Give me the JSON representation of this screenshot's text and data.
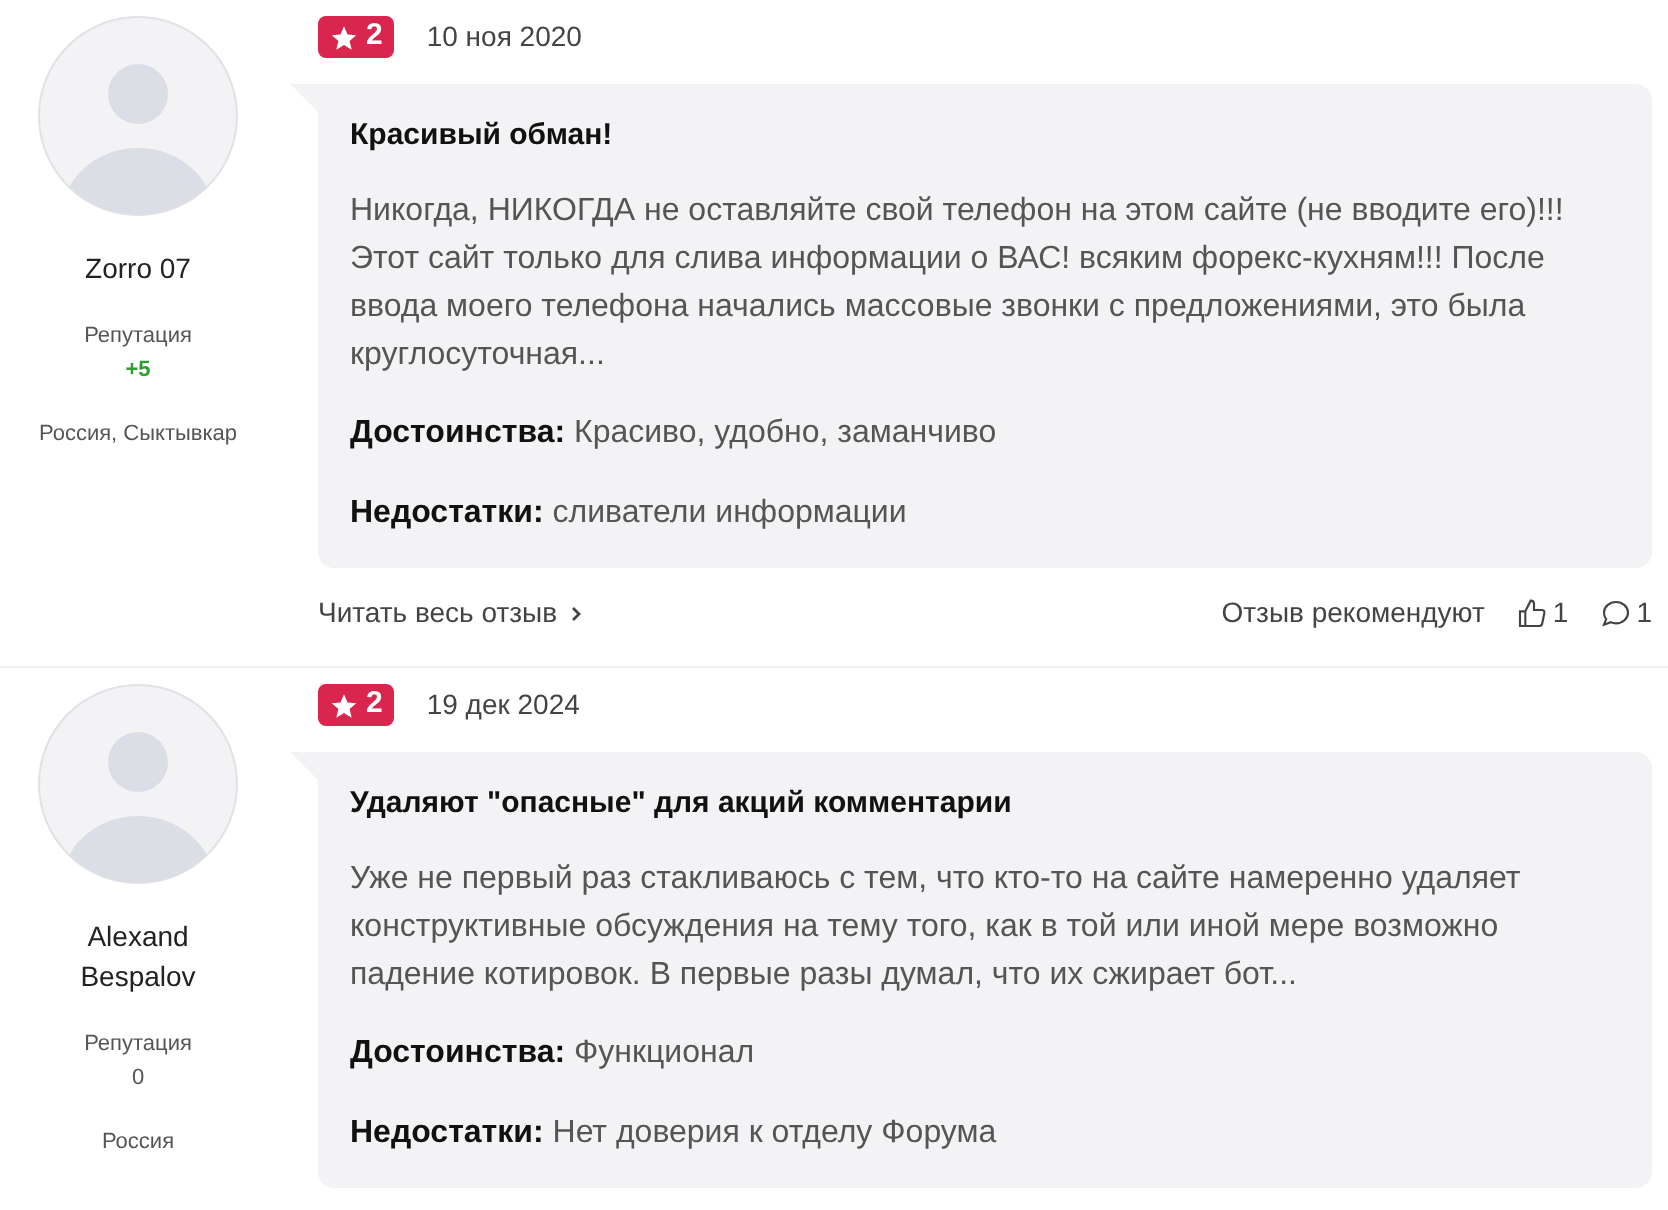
{
  "reviews": [
    {
      "author": "Zorro 07",
      "reputation_label": "Репутация",
      "reputation": "+5",
      "reputation_positive": true,
      "location": "Россия, Сыктывкар",
      "rating": "2",
      "date": "10 ноя 2020",
      "title": "Красивый обман!",
      "body": "Никогда, НИКОГДА не оставляйте свой телефон на этом сайте (не вводите его)!!! Этот сайт только для слива информации о ВАС! всяким форекс-кухням!!! После ввода моего телефона начались массовые звонки с предложениями, это была круглосуточная...",
      "pros": "**Достоинства:** Красиво, удобно, заманчиво",
      "cons": "**Недостатки:** сливатели информации",
      "footer": {
        "read_more": "Читать весь отзыв",
        "recommend_label": "Отзыв рекомендуют",
        "likes": "1",
        "comments": "1"
      }
    },
    {
      "author": "Alexand Bespalov",
      "reputation_label": "Репутация",
      "reputation": "0",
      "reputation_positive": false,
      "location": "Россия",
      "rating": "2",
      "date": "19 дек 2024",
      "title": "Удаляют \"опасные\" для акций комментарии",
      "body": "Уже не первый раз стакливаюсь с тем, что кто-то на сайте намеренно удаляет конструктивные обсуждения на тему того, как в той или иной мере возможно падение котировок. В первые разы думал, что их сжирает бот...",
      "pros": "**Достоинства:** Функционал",
      "cons": "**Недостатки:** Нет доверия к отделу Форума"
    }
  ]
}
